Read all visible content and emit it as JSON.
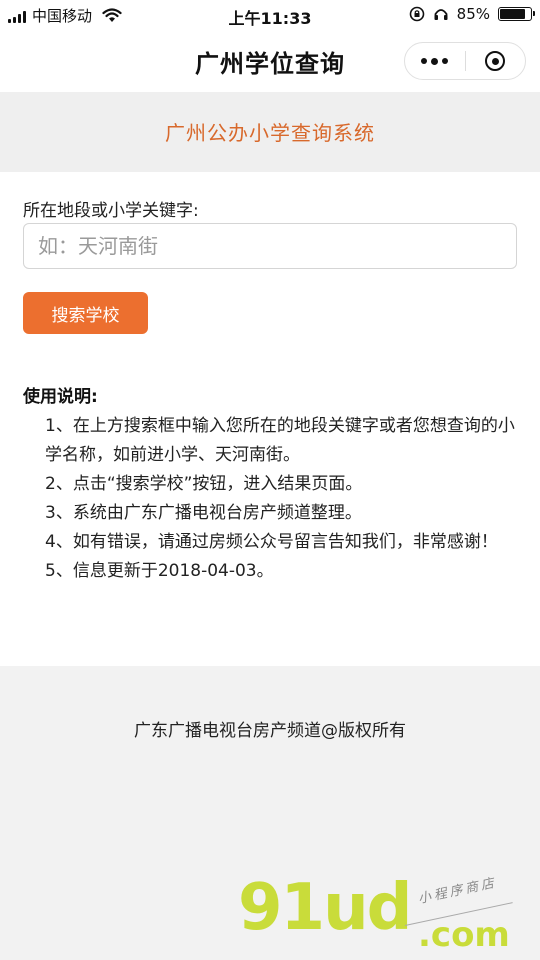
{
  "status_bar": {
    "carrier": "中国移动",
    "time": "上午11:33",
    "battery_text": "85%",
    "battery_level": 0.85
  },
  "navbar": {
    "title": "广州学位查询"
  },
  "header": {
    "title": "广州公办小学查询系统"
  },
  "search": {
    "label": "所在地段或小学关键字:",
    "placeholder": "如：天河南街",
    "value": "",
    "button_label": "搜索学校"
  },
  "instructions": {
    "title": "使用说明:",
    "items": [
      "1、在上方搜索框中输入您所在的地段关键字或者您想查询的小学名称，如前进小学、天河南街。",
      "2、点击“搜索学校”按钮，进入结果页面。",
      "3、系统由广东广播电视台房产频道整理。",
      "4、如有错误，请通过房频公众号留言告知我们，非常感谢！",
      "5、信息更新于2018-04-03。"
    ]
  },
  "footer": {
    "copyright": "广东广播电视台房产频道@版权所有"
  },
  "watermark": {
    "logo": "91ud",
    "suffix": ".com",
    "tagline": "小程序商店"
  },
  "colors": {
    "accent": "#ec6f2f",
    "header_title": "#d8692c",
    "watermark": "#c9dc3a"
  }
}
